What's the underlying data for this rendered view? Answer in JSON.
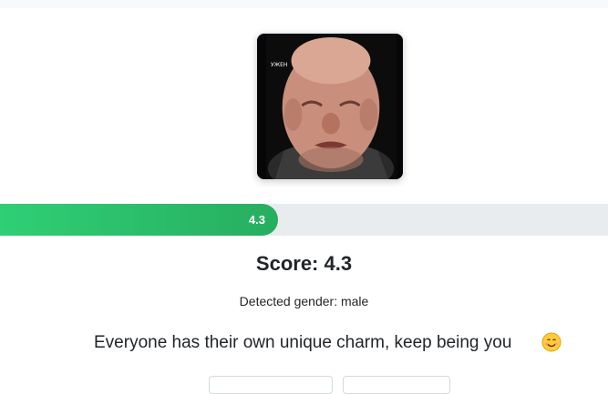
{
  "photo": {
    "caption": "УЖЕН"
  },
  "progress": {
    "value": 4.3,
    "max": 10,
    "label": "4.3",
    "fill_color_start": "#2fcf75",
    "fill_color_end": "#27ae60",
    "track_color": "#e9ecef"
  },
  "result": {
    "score_text": "Score: 4.3",
    "gender_text": "Detected gender: male",
    "message": "Everyone has their own unique charm, keep being you",
    "message_icon": "smiling-face-icon"
  }
}
